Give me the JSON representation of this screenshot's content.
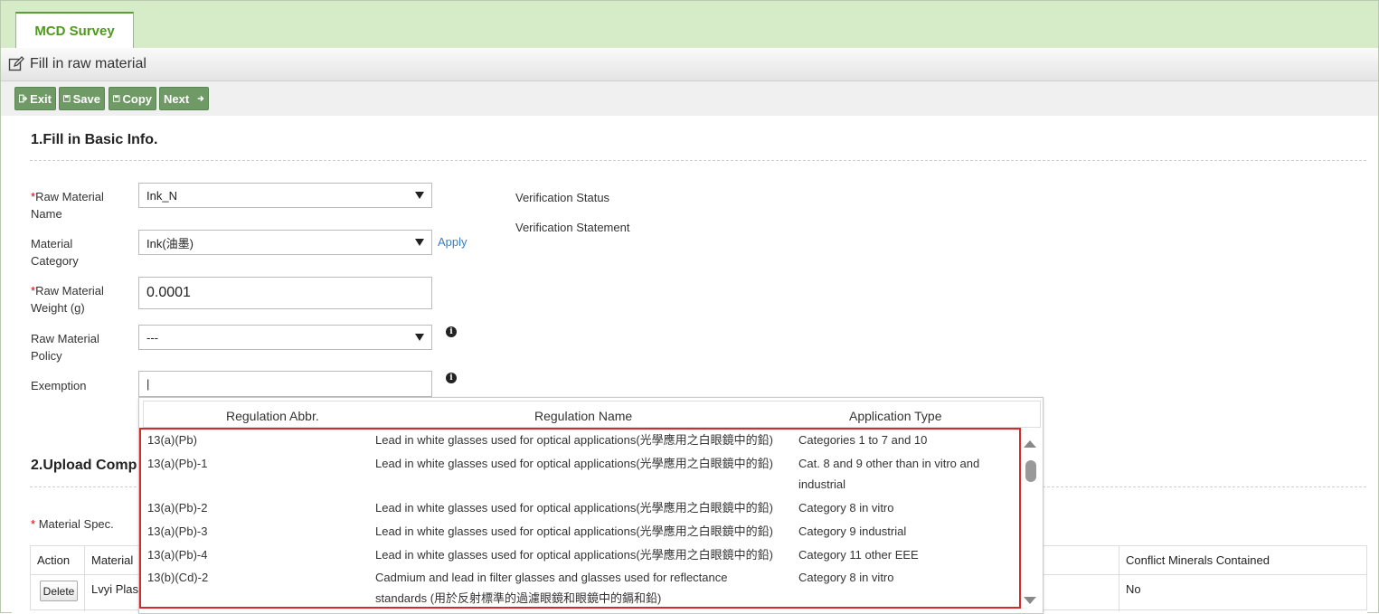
{
  "tab": {
    "label": "MCD Survey"
  },
  "title": {
    "text": "Fill in raw material",
    "icon": "edit-icon"
  },
  "toolbar": {
    "exit": "Exit",
    "save": "Save",
    "copy": "Copy",
    "next": "Next",
    "button_color": "#6f9a66"
  },
  "section1": {
    "title": "1.Fill in Basic Info."
  },
  "form": {
    "raw_material_name": {
      "req": "*",
      "label": "Raw Material Name",
      "value": "Ink_N"
    },
    "material_category": {
      "label": "Material Category",
      "value": "Ink(油墨)",
      "apply": "Apply"
    },
    "raw_material_weight": {
      "req": "*",
      "label": "Raw Material Weight (g)",
      "value": "0.0001"
    },
    "raw_material_policy": {
      "label": "Raw Material Policy",
      "value": "---"
    },
    "exemption": {
      "label": "Exemption",
      "value": "|"
    },
    "verification_status": "Verification Status",
    "verification_statement": "Verification Statement"
  },
  "section2": {
    "title": "2.Upload Comp"
  },
  "material_spec": {
    "req": "*",
    "label": "Material Spec."
  },
  "bg_table": {
    "headers": {
      "action": "Action",
      "material": "Material",
      "conflict": "Conflict Minerals Contained"
    },
    "row": {
      "delete": "Delete",
      "material": "Lvyi Plas",
      "conflict": "No"
    }
  },
  "popup": {
    "headers": {
      "abbr": "Regulation Abbr.",
      "name": "Regulation Name",
      "type": "Application Type"
    },
    "rows": [
      {
        "abbr": "13(a)(Pb)",
        "name": "Lead in white glasses used for optical applications(光學應用之白眼鏡中的鉛)",
        "type": "Categories 1 to 7 and 10",
        "type2": ""
      },
      {
        "abbr": "13(a)(Pb)-1",
        "name": "Lead in white glasses used for optical applications(光學應用之白眼鏡中的鉛)",
        "type": "Cat. 8 and 9 other than in vitro and",
        "type2": "industrial"
      },
      {
        "abbr": "13(a)(Pb)-2",
        "name": "Lead in white glasses used for optical applications(光學應用之白眼鏡中的鉛)",
        "type": "Category 8 in vitro",
        "type2": ""
      },
      {
        "abbr": "13(a)(Pb)-3",
        "name": "Lead in white glasses used for optical applications(光學應用之白眼鏡中的鉛)",
        "type": "Category 9 industrial",
        "type2": ""
      },
      {
        "abbr": "13(a)(Pb)-4",
        "name": "Lead in white glasses used for optical applications(光學應用之白眼鏡中的鉛)",
        "type": "Category 11 other EEE",
        "type2": ""
      },
      {
        "abbr": "13(b)(Cd)-2",
        "name": "Cadmium and lead in filter glasses and glasses used for reflectance",
        "name2": "standards (用於反射標準的過濾眼鏡和眼鏡中的鎘和鉛)",
        "type": "Category 8 in vitro",
        "type2": ""
      }
    ],
    "highlight_color": "#d42a2a"
  }
}
